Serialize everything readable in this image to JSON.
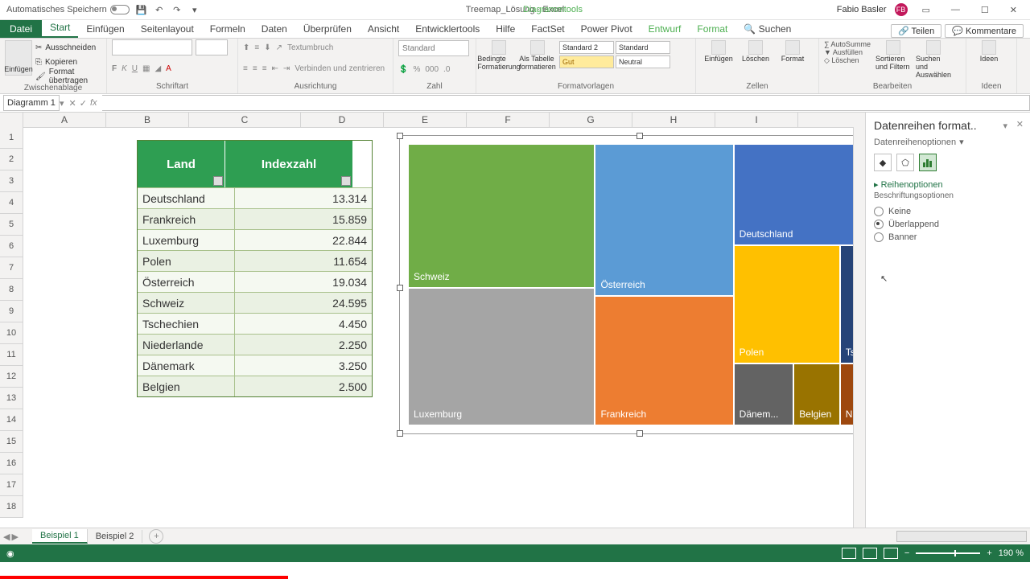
{
  "title": {
    "autosave": "Automatisches Speichern",
    "doc": "Treemap_Lösung",
    "app": "Excel",
    "tooltab": "Diagrammtools",
    "user": "Fabio Basler",
    "share": "Teilen",
    "comments": "Kommentare"
  },
  "tabs": {
    "file": "Datei",
    "list": [
      "Start",
      "Einfügen",
      "Seitenlayout",
      "Formeln",
      "Daten",
      "Überprüfen",
      "Ansicht",
      "Entwicklertools",
      "Hilfe",
      "FactSet",
      "Power Pivot",
      "Entwurf",
      "Format"
    ],
    "search": "Suchen"
  },
  "ribbon": {
    "clipboard": {
      "label": "Zwischenablage",
      "paste": "Einfügen",
      "cut": "Ausschneiden",
      "copy": "Kopieren",
      "painter": "Format übertragen"
    },
    "font": {
      "label": "Schriftart"
    },
    "align": {
      "label": "Ausrichtung",
      "wrap": "Textumbruch",
      "merge": "Verbinden und zentrieren"
    },
    "number": {
      "label": "Zahl",
      "fmt": "Standard"
    },
    "styles": {
      "label": "Formatvorlagen",
      "cond": "Bedingte Formatierung",
      "table": "Als Tabelle formatieren",
      "s1": "Standard 2",
      "s2": "Standard",
      "s3": "Gut",
      "s4": "Neutral"
    },
    "cells": {
      "label": "Zellen",
      "insert": "Einfügen",
      "delete": "Löschen",
      "format": "Format"
    },
    "edit": {
      "label": "Bearbeiten",
      "sum": "AutoSumme",
      "fill": "Ausfüllen",
      "clear": "Löschen",
      "sort": "Sortieren und Filtern",
      "find": "Suchen und Auswählen"
    },
    "ideas": {
      "label": "Ideen",
      "btn": "Ideen"
    }
  },
  "namebox": "Diagramm 1",
  "cols": [
    "A",
    "B",
    "C",
    "D",
    "E",
    "F",
    "G",
    "H",
    "I"
  ],
  "rows": [
    1,
    2,
    3,
    4,
    5,
    6,
    7,
    8,
    9,
    10,
    11,
    12,
    13,
    14,
    15,
    16,
    17,
    18
  ],
  "table": {
    "headers": [
      "Land",
      "Indexzahl"
    ],
    "rows": [
      [
        "Deutschland",
        "13.314"
      ],
      [
        "Frankreich",
        "15.859"
      ],
      [
        "Luxemburg",
        "22.844"
      ],
      [
        "Polen",
        "11.654"
      ],
      [
        "Österreich",
        "19.034"
      ],
      [
        "Schweiz",
        "24.595"
      ],
      [
        "Tschechien",
        "4.450"
      ],
      [
        "Niederlande",
        "2.250"
      ],
      [
        "Dänemark",
        "3.250"
      ],
      [
        "Belgien",
        "2.500"
      ]
    ]
  },
  "chart_data": {
    "type": "treemap",
    "series": [
      {
        "name": "Schweiz",
        "value": 24595,
        "color": "#70ad47"
      },
      {
        "name": "Luxemburg",
        "value": 22844,
        "color": "#a5a5a5"
      },
      {
        "name": "Österreich",
        "value": 19034,
        "color": "#5b9bd5"
      },
      {
        "name": "Frankreich",
        "value": 15859,
        "color": "#ed7d31"
      },
      {
        "name": "Deutschland",
        "value": 13314,
        "color": "#4472c4"
      },
      {
        "name": "Polen",
        "value": 11654,
        "color": "#ffc000"
      },
      {
        "name": "Tschechien",
        "value": 4450,
        "color": "#264478"
      },
      {
        "name": "Dänemark",
        "value": 3250,
        "color": "#636363"
      },
      {
        "name": "Belgien",
        "value": 2500,
        "color": "#997300"
      },
      {
        "name": "Niederlande",
        "value": 2250,
        "color": "#9e480e"
      }
    ]
  },
  "tiles": {
    "schweiz": "Schweiz",
    "luxemburg": "Luxemburg",
    "oesterreich": "Österreich",
    "frankreich": "Frankreich",
    "deutschland": "Deutschland",
    "polen": "Polen",
    "tsch": "Tsch...",
    "daen": "Dänem...",
    "belgien": "Belgien",
    "nie": "Nie..."
  },
  "panel": {
    "title": "Datenreihen format..",
    "sub": "Datenreihenoptionen",
    "section": "Reihenoptionen",
    "link": "Beschriftungsoptionen",
    "opt1": "Keine",
    "opt2": "Überlappend",
    "opt3": "Banner"
  },
  "sheets": {
    "s1": "Beispiel 1",
    "s2": "Beispiel 2"
  },
  "status": {
    "zoom": "190 %"
  }
}
